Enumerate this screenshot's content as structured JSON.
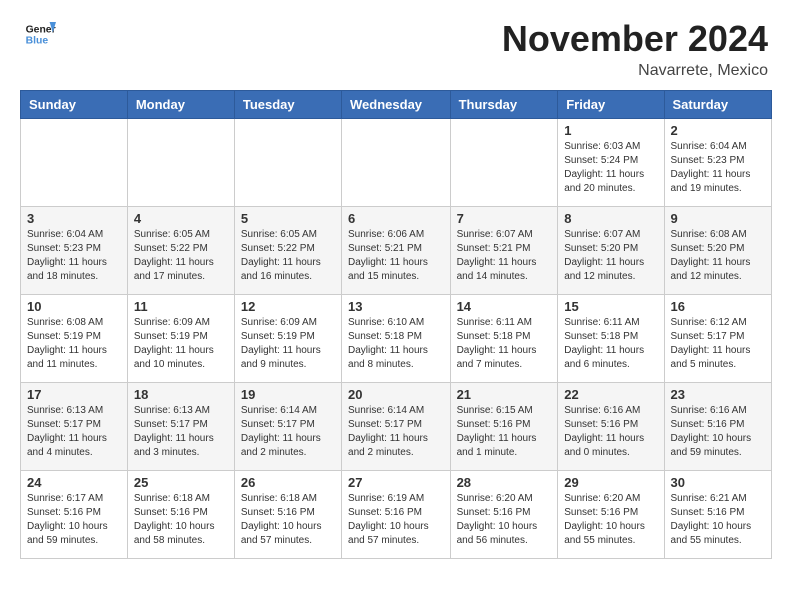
{
  "logo": {
    "line1": "General",
    "line2": "Blue"
  },
  "title": "November 2024",
  "subtitle": "Navarrete, Mexico",
  "days_header": [
    "Sunday",
    "Monday",
    "Tuesday",
    "Wednesday",
    "Thursday",
    "Friday",
    "Saturday"
  ],
  "weeks": [
    [
      {
        "day": "",
        "info": ""
      },
      {
        "day": "",
        "info": ""
      },
      {
        "day": "",
        "info": ""
      },
      {
        "day": "",
        "info": ""
      },
      {
        "day": "",
        "info": ""
      },
      {
        "day": "1",
        "info": "Sunrise: 6:03 AM\nSunset: 5:24 PM\nDaylight: 11 hours and 20 minutes."
      },
      {
        "day": "2",
        "info": "Sunrise: 6:04 AM\nSunset: 5:23 PM\nDaylight: 11 hours and 19 minutes."
      }
    ],
    [
      {
        "day": "3",
        "info": "Sunrise: 6:04 AM\nSunset: 5:23 PM\nDaylight: 11 hours and 18 minutes."
      },
      {
        "day": "4",
        "info": "Sunrise: 6:05 AM\nSunset: 5:22 PM\nDaylight: 11 hours and 17 minutes."
      },
      {
        "day": "5",
        "info": "Sunrise: 6:05 AM\nSunset: 5:22 PM\nDaylight: 11 hours and 16 minutes."
      },
      {
        "day": "6",
        "info": "Sunrise: 6:06 AM\nSunset: 5:21 PM\nDaylight: 11 hours and 15 minutes."
      },
      {
        "day": "7",
        "info": "Sunrise: 6:07 AM\nSunset: 5:21 PM\nDaylight: 11 hours and 14 minutes."
      },
      {
        "day": "8",
        "info": "Sunrise: 6:07 AM\nSunset: 5:20 PM\nDaylight: 11 hours and 12 minutes."
      },
      {
        "day": "9",
        "info": "Sunrise: 6:08 AM\nSunset: 5:20 PM\nDaylight: 11 hours and 12 minutes."
      }
    ],
    [
      {
        "day": "10",
        "info": "Sunrise: 6:08 AM\nSunset: 5:19 PM\nDaylight: 11 hours and 11 minutes."
      },
      {
        "day": "11",
        "info": "Sunrise: 6:09 AM\nSunset: 5:19 PM\nDaylight: 11 hours and 10 minutes."
      },
      {
        "day": "12",
        "info": "Sunrise: 6:09 AM\nSunset: 5:19 PM\nDaylight: 11 hours and 9 minutes."
      },
      {
        "day": "13",
        "info": "Sunrise: 6:10 AM\nSunset: 5:18 PM\nDaylight: 11 hours and 8 minutes."
      },
      {
        "day": "14",
        "info": "Sunrise: 6:11 AM\nSunset: 5:18 PM\nDaylight: 11 hours and 7 minutes."
      },
      {
        "day": "15",
        "info": "Sunrise: 6:11 AM\nSunset: 5:18 PM\nDaylight: 11 hours and 6 minutes."
      },
      {
        "day": "16",
        "info": "Sunrise: 6:12 AM\nSunset: 5:17 PM\nDaylight: 11 hours and 5 minutes."
      }
    ],
    [
      {
        "day": "17",
        "info": "Sunrise: 6:13 AM\nSunset: 5:17 PM\nDaylight: 11 hours and 4 minutes."
      },
      {
        "day": "18",
        "info": "Sunrise: 6:13 AM\nSunset: 5:17 PM\nDaylight: 11 hours and 3 minutes."
      },
      {
        "day": "19",
        "info": "Sunrise: 6:14 AM\nSunset: 5:17 PM\nDaylight: 11 hours and 2 minutes."
      },
      {
        "day": "20",
        "info": "Sunrise: 6:14 AM\nSunset: 5:17 PM\nDaylight: 11 hours and 2 minutes."
      },
      {
        "day": "21",
        "info": "Sunrise: 6:15 AM\nSunset: 5:16 PM\nDaylight: 11 hours and 1 minute."
      },
      {
        "day": "22",
        "info": "Sunrise: 6:16 AM\nSunset: 5:16 PM\nDaylight: 11 hours and 0 minutes."
      },
      {
        "day": "23",
        "info": "Sunrise: 6:16 AM\nSunset: 5:16 PM\nDaylight: 10 hours and 59 minutes."
      }
    ],
    [
      {
        "day": "24",
        "info": "Sunrise: 6:17 AM\nSunset: 5:16 PM\nDaylight: 10 hours and 59 minutes."
      },
      {
        "day": "25",
        "info": "Sunrise: 6:18 AM\nSunset: 5:16 PM\nDaylight: 10 hours and 58 minutes."
      },
      {
        "day": "26",
        "info": "Sunrise: 6:18 AM\nSunset: 5:16 PM\nDaylight: 10 hours and 57 minutes."
      },
      {
        "day": "27",
        "info": "Sunrise: 6:19 AM\nSunset: 5:16 PM\nDaylight: 10 hours and 57 minutes."
      },
      {
        "day": "28",
        "info": "Sunrise: 6:20 AM\nSunset: 5:16 PM\nDaylight: 10 hours and 56 minutes."
      },
      {
        "day": "29",
        "info": "Sunrise: 6:20 AM\nSunset: 5:16 PM\nDaylight: 10 hours and 55 minutes."
      },
      {
        "day": "30",
        "info": "Sunrise: 6:21 AM\nSunset: 5:16 PM\nDaylight: 10 hours and 55 minutes."
      }
    ]
  ]
}
